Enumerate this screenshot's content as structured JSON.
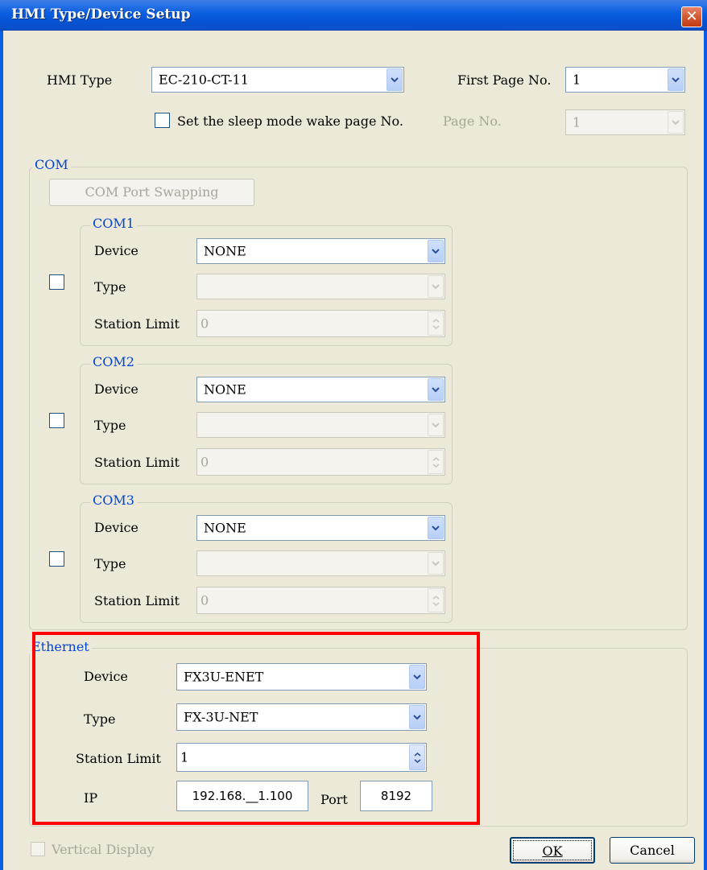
{
  "window": {
    "title": "HMI Type/Device Setup",
    "close_glyph": "✕"
  },
  "hmi_type": {
    "label": "HMI Type",
    "value": "EC-210-CT-11"
  },
  "first_page": {
    "label": "First Page No.",
    "value": "1"
  },
  "sleep_mode": {
    "label": "Set the sleep mode wake page No.",
    "page_label": "Page No.",
    "page_value": "1"
  },
  "com": {
    "legend": "COM",
    "swap_button": "COM Port Swapping",
    "ports": [
      {
        "legend": "COM1",
        "device_label": "Device",
        "device_value": "NONE",
        "type_label": "Type",
        "type_value": "",
        "station_label": "Station Limit",
        "station_value": "0"
      },
      {
        "legend": "COM2",
        "device_label": "Device",
        "device_value": "NONE",
        "type_label": "Type",
        "type_value": "",
        "station_label": "Station Limit",
        "station_value": "0"
      },
      {
        "legend": "COM3",
        "device_label": "Device",
        "device_value": "NONE",
        "type_label": "Type",
        "type_value": "",
        "station_label": "Station Limit",
        "station_value": "0"
      }
    ]
  },
  "ethernet": {
    "legend": "Ethernet",
    "device_label": "Device",
    "device_value": "FX3U-ENET",
    "type_label": "Type",
    "type_value": "FX-3U-NET",
    "station_label": "Station Limit",
    "station_value": "1",
    "ip_label": "IP",
    "ip_value": "192.168.__1.100",
    "port_label": "Port",
    "port_value": "8192"
  },
  "vertical_display": {
    "label": "Vertical Display"
  },
  "buttons": {
    "ok": "OK",
    "cancel": "Cancel"
  },
  "colors": {
    "highlight": "#ff0000",
    "legend": "#0046d5",
    "titlebar": "#0a5ee0"
  },
  "icons": {
    "dropdown": "chevron-down-icon",
    "spinner": "spin-arrows-icon",
    "close": "close-icon"
  }
}
